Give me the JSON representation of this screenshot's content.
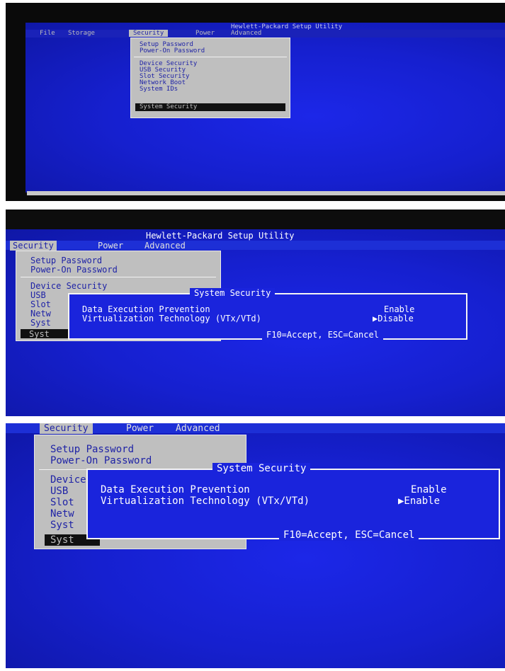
{
  "app_title": "Hewlett-Packard Setup Utility",
  "menus": {
    "file": "File",
    "storage": "Storage",
    "security": "Security",
    "power": "Power",
    "advanced": "Advanced"
  },
  "dropdown_items": {
    "setup_password": "Setup Password",
    "power_on_password": "Power-On Password",
    "device_security": "Device Security",
    "usb_security": "USB Security",
    "slot_security": "Slot Security",
    "network_boot": "Network Boot",
    "system_ids": "System IDs",
    "system_security": "System Security"
  },
  "truncated_items": {
    "usb": "USB",
    "slot": "Slot",
    "network": "Netw",
    "system_ids": "Syst",
    "system_security": "Syst"
  },
  "dialog": {
    "title": "System Security",
    "dep_label": "Data Execution Prevention",
    "dep_value": "Enable",
    "vt_label": "Virtualization Technology (VTx/VTd)",
    "vt_value_before": "▶Disable",
    "vt_value_after": "▶Enable",
    "footer": "F10=Accept, ESC=Cancel"
  },
  "colors": {
    "bios_background": "#1620cf",
    "menu_bar": "#1d2fd6",
    "dropdown": "#bfbfbf",
    "dropdown_text": "#1f23a6",
    "selection": "#111111"
  }
}
